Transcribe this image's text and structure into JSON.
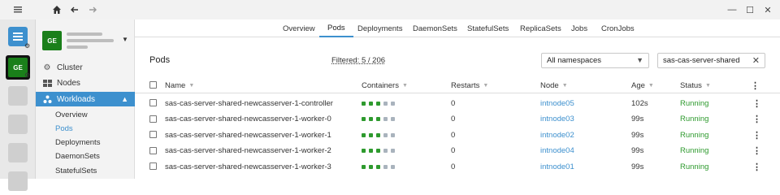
{
  "window": {
    "menu_icon": "hamburger-icon",
    "home_icon": "home-icon",
    "back_icon": "arrow-left-icon",
    "forward_icon": "arrow-right-icon",
    "minimize": "—",
    "maximize": "☐",
    "close": "✕"
  },
  "rail": {
    "cluster_badge": "GE"
  },
  "sidebar": {
    "badge": "GE",
    "items": {
      "cluster": "Cluster",
      "nodes": "Nodes",
      "workloads": "Workloads"
    },
    "sub": {
      "overview": "Overview",
      "pods": "Pods",
      "deployments": "Deployments",
      "daemonsets": "DaemonSets",
      "statefulsets": "StatefulSets"
    }
  },
  "tabs": {
    "overview": "Overview",
    "pods": "Pods",
    "deployments": "Deployments",
    "daemonsets": "DaemonSets",
    "statefulsets": "StatefulSets",
    "replicasets": "ReplicaSets",
    "jobs": "Jobs",
    "cronjobs": "CronJobs"
  },
  "main": {
    "title": "Pods",
    "filtered": "Filtered: 5 / 206",
    "namespace_select": "All namespaces",
    "search_value": "sas-cas-server-shared"
  },
  "table": {
    "headers": {
      "name": "Name",
      "containers": "Containers",
      "restarts": "Restarts",
      "node": "Node",
      "age": "Age",
      "status": "Status"
    },
    "rows": [
      {
        "name": "sas-cas-server-shared-newcasserver-1-controller",
        "restarts": "0",
        "node": "intnode05",
        "age": "102s",
        "status": "Running"
      },
      {
        "name": "sas-cas-server-shared-newcasserver-1-worker-0",
        "restarts": "0",
        "node": "intnode03",
        "age": "99s",
        "status": "Running"
      },
      {
        "name": "sas-cas-server-shared-newcasserver-1-worker-1",
        "restarts": "0",
        "node": "intnode02",
        "age": "99s",
        "status": "Running"
      },
      {
        "name": "sas-cas-server-shared-newcasserver-1-worker-2",
        "restarts": "0",
        "node": "intnode04",
        "age": "99s",
        "status": "Running"
      },
      {
        "name": "sas-cas-server-shared-newcasserver-1-worker-3",
        "restarts": "0",
        "node": "intnode01",
        "age": "99s",
        "status": "Running"
      }
    ]
  },
  "colors": {
    "accent": "#3d90ce",
    "running": "#2e9a2e",
    "container_ready": "#2e9a2e",
    "container_other": "#a9b3bd"
  }
}
